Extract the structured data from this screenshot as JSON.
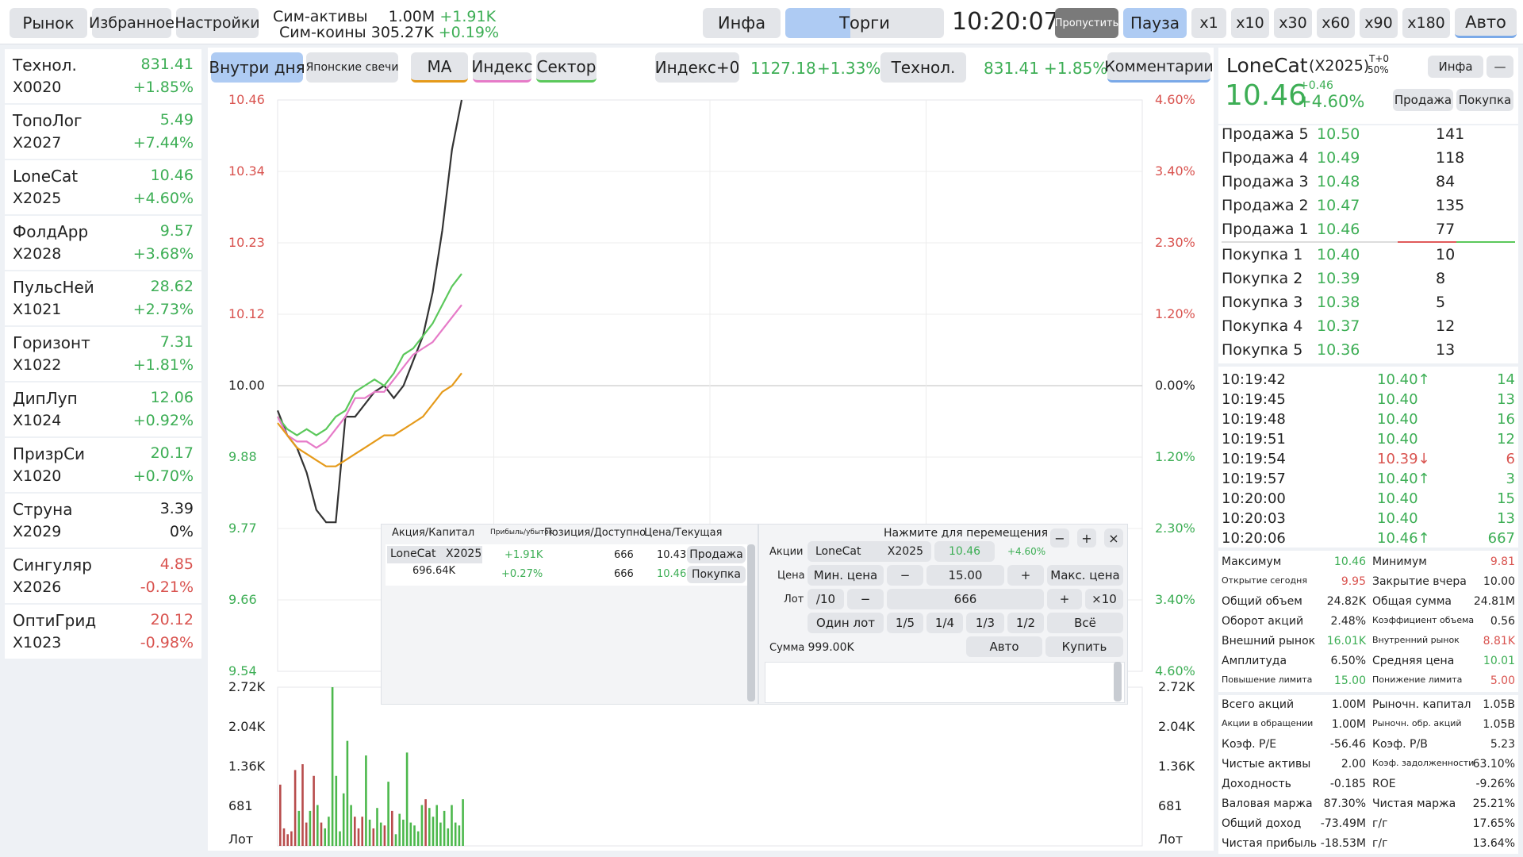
{
  "topbar": {
    "tabs": [
      "Рынок",
      "Избранное",
      "Настройки"
    ],
    "sim_assets_label": "Сим-активы",
    "sim_assets_value": "1.00M",
    "sim_assets_change": "+1.91K",
    "sim_coins_label": "Сим-коины",
    "sim_coins_value": "305.27K",
    "sim_coins_change": "+0.19%",
    "info_label": "Инфа",
    "trade_label": "Торги",
    "clock": "10:20:07",
    "skip_label": "Пропустить",
    "pause_label": "Пауза",
    "speeds": [
      "x1",
      "x10",
      "x30",
      "x60",
      "x90",
      "x180"
    ],
    "auto_label": "Авто"
  },
  "watchlist": [
    {
      "name": "Технол.",
      "code": "X0020",
      "price": "831.41",
      "change": "+1.85%",
      "dir": "up"
    },
    {
      "name": "ТопоЛог",
      "code": "X2027",
      "price": "5.49",
      "change": "+7.44%",
      "dir": "up"
    },
    {
      "name": "LoneCat",
      "code": "X2025",
      "price": "10.46",
      "change": "+4.60%",
      "dir": "up"
    },
    {
      "name": "ФолдАрр",
      "code": "X2028",
      "price": "9.57",
      "change": "+3.68%",
      "dir": "up"
    },
    {
      "name": "ПульсНей",
      "code": "X1021",
      "price": "28.62",
      "change": "+2.73%",
      "dir": "up"
    },
    {
      "name": "Горизонт",
      "code": "X1022",
      "price": "7.31",
      "change": "+1.81%",
      "dir": "up"
    },
    {
      "name": "ДипЛуп",
      "code": "X1024",
      "price": "12.06",
      "change": "+0.92%",
      "dir": "up"
    },
    {
      "name": "ПризрСи",
      "code": "X1020",
      "price": "20.17",
      "change": "+0.70%",
      "dir": "up"
    },
    {
      "name": "Струна",
      "code": "X2029",
      "price": "3.39",
      "change": "0%",
      "dir": "flat"
    },
    {
      "name": "Сингуляр",
      "code": "X2026",
      "price": "4.85",
      "change": "-0.21%",
      "dir": "down"
    },
    {
      "name": "ОптиГрид",
      "code": "X1023",
      "price": "20.12",
      "change": "-0.98%",
      "dir": "down"
    }
  ],
  "chart_toolbar": {
    "intraday": "Внутри дня",
    "candles": "Японские свечи",
    "ma": "MA",
    "index": "Индекс",
    "sector": "Сектор",
    "index_btn": "Индекс+0",
    "index_value": "1127.18",
    "index_change": "+1.33%",
    "sector_btn": "Технол.",
    "sector_value": "831.41",
    "sector_change": "+1.85%",
    "comments": "Комментарии"
  },
  "chart_data": {
    "type": "line",
    "y_left_ticks": [
      "10.46",
      "10.34",
      "10.23",
      "10.12",
      "10.00",
      "9.88",
      "9.77",
      "9.66",
      "9.54"
    ],
    "y_right_ticks": [
      "4.60%",
      "3.40%",
      "2.30%",
      "1.20%",
      "0.00%",
      "1.20%",
      "2.30%",
      "3.40%",
      "4.60%"
    ],
    "ylim": [
      9.54,
      10.46
    ],
    "series": [
      {
        "name": "",
        "color": "#333333",
        "values": [
          9.96,
          9.92,
          9.9,
          9.86,
          9.8,
          9.78,
          9.78,
          9.95,
          9.95,
          9.97,
          9.99,
          10.0,
          9.98,
          10.0,
          10.04,
          10.08,
          10.15,
          10.25,
          10.38,
          10.46
        ]
      },
      {
        "name": "",
        "color": "#5bc85b",
        "values": [
          9.95,
          9.93,
          9.92,
          9.93,
          9.92,
          9.93,
          9.95,
          9.96,
          9.99,
          10.0,
          10.01,
          10.0,
          10.02,
          10.05,
          10.06,
          10.08,
          10.1,
          10.13,
          10.16,
          10.18
        ]
      },
      {
        "name": "",
        "color": "#e67bc8",
        "values": [
          9.95,
          9.92,
          9.91,
          9.91,
          9.9,
          9.91,
          9.93,
          9.95,
          9.98,
          9.98,
          9.99,
          9.99,
          10.01,
          10.03,
          10.05,
          10.06,
          10.07,
          10.09,
          10.11,
          10.13
        ]
      },
      {
        "name": "",
        "color": "#e59a1a",
        "values": [
          9.94,
          9.92,
          9.9,
          9.89,
          9.88,
          9.87,
          9.87,
          9.88,
          9.89,
          9.9,
          9.91,
          9.92,
          9.92,
          9.93,
          9.94,
          9.95,
          9.97,
          9.99,
          10.0,
          10.02
        ]
      }
    ],
    "volume_ticks": [
      "2.72K",
      "2.04K",
      "1.36K",
      "681",
      "Лот"
    ],
    "volume": [
      1050,
      300,
      200,
      250,
      1300,
      600,
      1400,
      400,
      600,
      1200,
      700,
      400,
      300,
      500,
      2720,
      1200,
      250,
      900,
      1800,
      700,
      500,
      300,
      500,
      1550,
      450,
      300,
      650,
      400,
      350,
      1100,
      600,
      200,
      550,
      450,
      1600,
      400,
      350,
      250,
      700,
      800,
      650,
      500,
      700,
      400,
      600,
      300,
      700,
      400,
      350,
      800
    ],
    "volume_dirs": [
      "d",
      "d",
      "d",
      "d",
      "d",
      "u",
      "d",
      "d",
      "u",
      "d",
      "u",
      "d",
      "u",
      "u",
      "u",
      "u",
      "u",
      "u",
      "u",
      "u",
      "d",
      "d",
      "d",
      "u",
      "u",
      "d",
      "u",
      "u",
      "d",
      "u",
      "d",
      "u",
      "u",
      "u",
      "u",
      "u",
      "u",
      "u",
      "u",
      "d",
      "u",
      "u",
      "u",
      "u",
      "u",
      "u",
      "u",
      "u",
      "u",
      "u"
    ]
  },
  "position_panel": {
    "headers": [
      "Акция/Капитал",
      "Прибыль/убыток",
      "Позиция/Доступно",
      "Цена/Текущая"
    ],
    "stock": "LoneCat",
    "code": "X2025",
    "capital": "696.64K",
    "pnl": "+1.91K",
    "pnl_pct": "+0.27%",
    "position": "666",
    "available": "666",
    "price": "10.43",
    "current": "10.46",
    "sell_label": "Продажа",
    "buy_label": "Покупка"
  },
  "order_panel": {
    "move_hint": "Нажмите для перемещения",
    "minus_btn": "−",
    "plus_btn": "+",
    "close_btn": "×",
    "shares_label": "Акции",
    "stock": "LoneCat",
    "code": "X2025",
    "price_now": "10.46",
    "change": "+4.60%",
    "price_label": "Цена",
    "min_price": "Мин. цена",
    "price_value": "15.00",
    "max_price": "Макс. цена",
    "lot_label": "Лот",
    "div10": "/10",
    "lot_value": "666",
    "mul10": "×10",
    "one_lot": "Один лот",
    "fractions": [
      "1/5",
      "1/4",
      "1/3",
      "1/2"
    ],
    "all": "Всё",
    "sum_label": "Сумма",
    "sum_value": "999.00K",
    "auto": "Авто",
    "buy": "Купить"
  },
  "quote": {
    "name": "LoneCat",
    "code": "(X2025)",
    "t0": "T+0",
    "margin": "50%",
    "info": "Инфа",
    "collapse": "—",
    "price": "10.46",
    "abs_change": "+0.46",
    "pct_change": "+4.60%",
    "sell": "Продажа",
    "buy": "Покупка"
  },
  "orderbook": {
    "asks": [
      {
        "label": "Продажа 5",
        "price": "10.50",
        "vol": "141"
      },
      {
        "label": "Продажа 4",
        "price": "10.49",
        "vol": "118"
      },
      {
        "label": "Продажа 3",
        "price": "10.48",
        "vol": "84"
      },
      {
        "label": "Продажа 2",
        "price": "10.47",
        "vol": "135"
      },
      {
        "label": "Продажа 1",
        "price": "10.46",
        "vol": "77"
      }
    ],
    "bids": [
      {
        "label": "Покупка 1",
        "price": "10.40",
        "vol": "10"
      },
      {
        "label": "Покупка 2",
        "price": "10.39",
        "vol": "8"
      },
      {
        "label": "Покупка 3",
        "price": "10.38",
        "vol": "5"
      },
      {
        "label": "Покупка 4",
        "price": "10.37",
        "vol": "12"
      },
      {
        "label": "Покупка 5",
        "price": "10.36",
        "vol": "13"
      }
    ]
  },
  "ticks": [
    {
      "time": "10:19:42",
      "price": "10.40↑",
      "vol": "14",
      "dir": "up"
    },
    {
      "time": "10:19:45",
      "price": "10.40",
      "vol": "13",
      "dir": "up"
    },
    {
      "time": "10:19:48",
      "price": "10.40",
      "vol": "16",
      "dir": "up"
    },
    {
      "time": "10:19:51",
      "price": "10.40",
      "vol": "12",
      "dir": "up"
    },
    {
      "time": "10:19:54",
      "price": "10.39↓",
      "vol": "6",
      "dir": "down"
    },
    {
      "time": "10:19:57",
      "price": "10.40↑",
      "vol": "3",
      "dir": "up"
    },
    {
      "time": "10:20:00",
      "price": "10.40",
      "vol": "15",
      "dir": "up"
    },
    {
      "time": "10:20:03",
      "price": "10.40",
      "vol": "13",
      "dir": "up"
    },
    {
      "time": "10:20:06",
      "price": "10.46↑",
      "vol": "667",
      "dir": "up"
    }
  ],
  "stats1": [
    {
      "k": "Максимум",
      "v": "10.46",
      "c": "green",
      "k2": "Минимум",
      "v2": "9.81",
      "c2": "red"
    },
    {
      "k": "Открытие сегодня",
      "v": "9.95",
      "c": "red",
      "k2": "Закрытие вчера",
      "v2": "10.00",
      "c2": ""
    },
    {
      "k": "Общий объем",
      "v": "24.82K",
      "c": "",
      "k2": "Общая сумма",
      "v2": "24.81M",
      "c2": ""
    },
    {
      "k": "Оборот акций",
      "v": "2.48%",
      "c": "",
      "k2": "Коэффициент объема",
      "v2": "0.56",
      "c2": ""
    },
    {
      "k": "Внешний рынок",
      "v": "16.01K",
      "c": "green",
      "k2": "Внутренний рынок",
      "v2": "8.81K",
      "c2": "red"
    },
    {
      "k": "Амплитуда",
      "v": "6.50%",
      "c": "",
      "k2": "Средняя цена",
      "v2": "10.01",
      "c2": "green"
    },
    {
      "k": "Повышение лимита",
      "v": "15.00",
      "c": "green",
      "k2": "Понижение лимита",
      "v2": "5.00",
      "c2": "red"
    }
  ],
  "stats2": [
    {
      "k": "Всего акций",
      "v": "1.00M",
      "k2": "Рыночн. капитал",
      "v2": "1.05B"
    },
    {
      "k": "Акции в обращении",
      "v": "1.00M",
      "k2": "Рыночн. обр. акций",
      "v2": "1.05B"
    },
    {
      "k": "Коэф. P/E",
      "v": "-56.46",
      "k2": "Коэф. P/B",
      "v2": "5.23"
    },
    {
      "k": "Чистые активы",
      "v": "2.00",
      "k2": "Коэф. задолженности",
      "v2": "63.10%"
    },
    {
      "k": "Доходность",
      "v": "-0.185",
      "k2": "ROE",
      "v2": "-9.26%"
    },
    {
      "k": "Валовая маржа",
      "v": "87.30%",
      "k2": "Чистая маржа",
      "v2": "25.21%"
    },
    {
      "k": "Общий доход",
      "v": "-73.49M",
      "k2": "г/г",
      "v2": "17.65%"
    },
    {
      "k": "Чистая прибыль",
      "v": "-18.53M",
      "k2": "г/г",
      "v2": "13.64%"
    }
  ]
}
